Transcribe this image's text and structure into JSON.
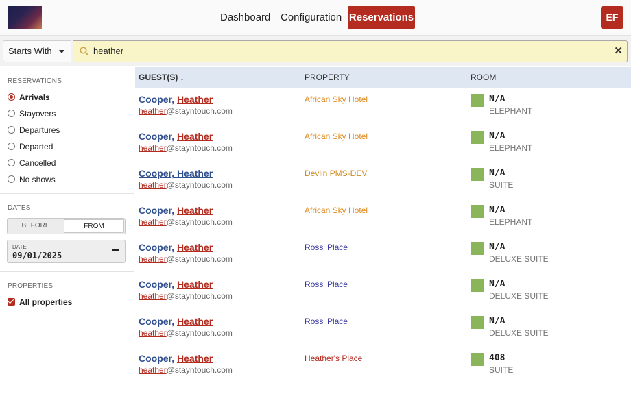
{
  "nav": {
    "dashboard": "Dashboard",
    "configuration": "Configuration",
    "reservations": "Reservations",
    "avatar": "EF"
  },
  "search": {
    "mode": "Starts With",
    "value": "heather"
  },
  "sidebar": {
    "reservations_title": "RESERVATIONS",
    "reservation_filters": [
      {
        "label": "Arrivals",
        "checked": true
      },
      {
        "label": "Stayovers",
        "checked": false
      },
      {
        "label": "Departures",
        "checked": false
      },
      {
        "label": "Departed",
        "checked": false
      },
      {
        "label": "Cancelled",
        "checked": false
      },
      {
        "label": "No shows",
        "checked": false
      }
    ],
    "dates_title": "DATES",
    "toggle_before": "BEFORE",
    "toggle_from": "FROM",
    "date_label": "DATE",
    "date_value": "09/01/2025",
    "properties_title": "PROPERTIES",
    "all_properties": "All properties"
  },
  "table": {
    "headers": {
      "guests": "GUEST(S) ↓",
      "property": "PROPERTY",
      "room": "ROOM"
    },
    "rows": [
      {
        "last": "Cooper",
        "sep": ", ",
        "first": "Heather",
        "email_hl": "heather",
        "email_rest": "@stayntouch.com",
        "property": "African Sky Hotel",
        "room": "N/A",
        "room_type": "ELEPHANT"
      },
      {
        "last": "Cooper",
        "sep": ", ",
        "first": "Heather",
        "email_hl": "heather",
        "email_rest": "@stayntouch.com",
        "property": "African Sky Hotel",
        "room": "N/A",
        "room_type": "ELEPHANT"
      },
      {
        "last": "Cooper",
        "sep": ", ",
        "first": "Heather",
        "email_hl": "heather",
        "email_rest": "@stayntouch.com",
        "property": "Devlin PMS-DEV",
        "room": "N/A",
        "room_type": "SUITE"
      },
      {
        "last": "Cooper",
        "sep": ", ",
        "first": "Heather",
        "email_hl": "heather",
        "email_rest": "@stayntouch.com",
        "property": "African Sky Hotel",
        "room": "N/A",
        "room_type": "ELEPHANT"
      },
      {
        "last": "Cooper",
        "sep": ", ",
        "first": "Heather",
        "email_hl": "heather",
        "email_rest": "@stayntouch.com",
        "property": "Ross' Place",
        "room": "N/A",
        "room_type": "DELUXE SUITE"
      },
      {
        "last": "Cooper",
        "sep": ", ",
        "first": "Heather",
        "email_hl": "heather",
        "email_rest": "@stayntouch.com",
        "property": "Ross' Place",
        "room": "N/A",
        "room_type": "DELUXE SUITE"
      },
      {
        "last": "Cooper",
        "sep": ", ",
        "first": "Heather",
        "email_hl": "heather",
        "email_rest": "@stayntouch.com",
        "property": "Ross' Place",
        "room": "N/A",
        "room_type": "DELUXE SUITE"
      },
      {
        "last": "Cooper",
        "sep": ", ",
        "first": "Heather",
        "email_hl": "heather",
        "email_rest": "@stayntouch.com",
        "property": "Heather's Place",
        "room": "408",
        "room_type": "SUITE"
      }
    ]
  },
  "colors": {
    "brand": "#b42b1f",
    "guest_name": "#2f4f8f",
    "room_swatch": "#8ab55a",
    "property_african_sky": "#e08a1e",
    "property_devlin": "#d08a1e",
    "property_ross": "#3a3aa0",
    "property_heathers": "#b42b1f"
  }
}
